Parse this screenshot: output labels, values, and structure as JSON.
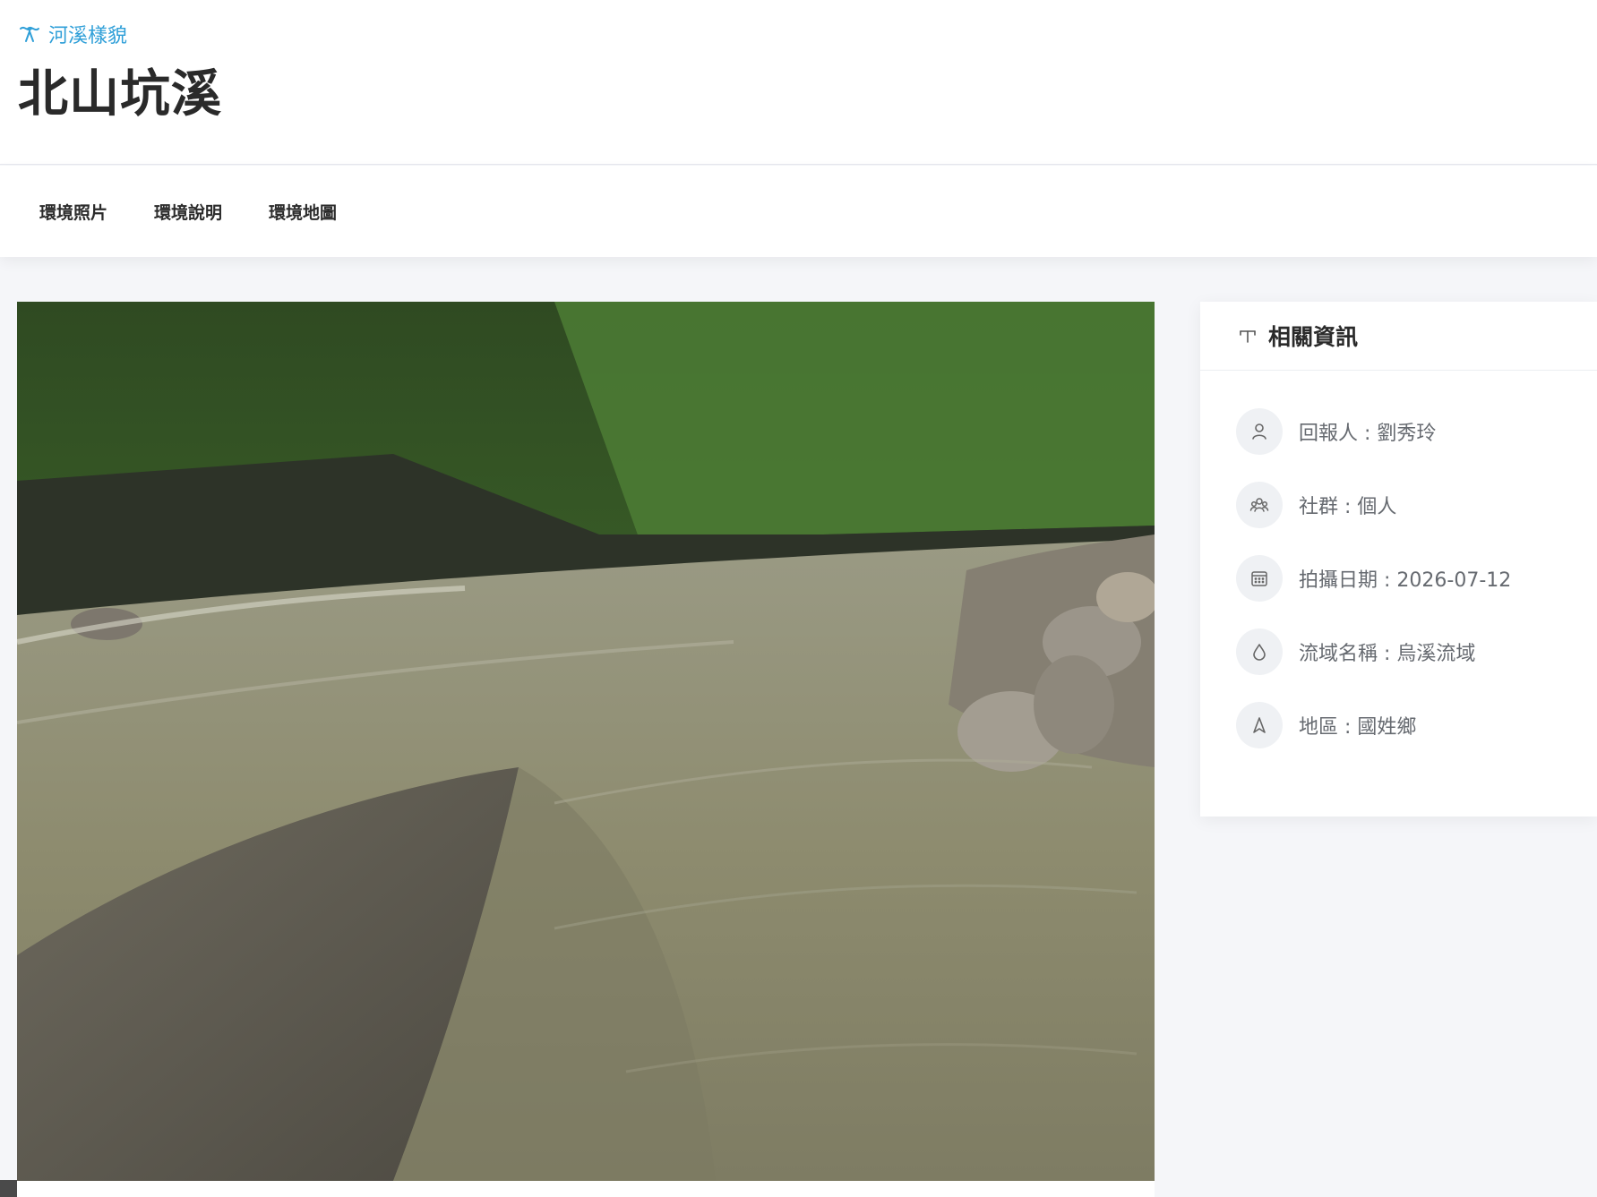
{
  "header": {
    "category_label": "河溪樣貌",
    "title": "北山坑溪"
  },
  "tabs": [
    {
      "label": "環境照片"
    },
    {
      "label": "環境說明"
    },
    {
      "label": "環境地圖"
    }
  ],
  "photo": {
    "subject": "river-environment-photo"
  },
  "info": {
    "title": "相關資訊",
    "items": [
      {
        "icon": "user-icon",
        "text": "回報人 : 劉秀玲"
      },
      {
        "icon": "group-icon",
        "text": "社群 : 個人"
      },
      {
        "icon": "calendar-icon",
        "text": "拍攝日期 : 2026-07-12"
      },
      {
        "icon": "water-drop-icon",
        "text": "流域名稱 : 烏溪流域"
      },
      {
        "icon": "location-icon",
        "text": "地區 : 國姓鄉"
      }
    ]
  },
  "colors": {
    "accent": "#2f9fd8",
    "background": "#f5f6f9",
    "card": "#ffffff"
  }
}
